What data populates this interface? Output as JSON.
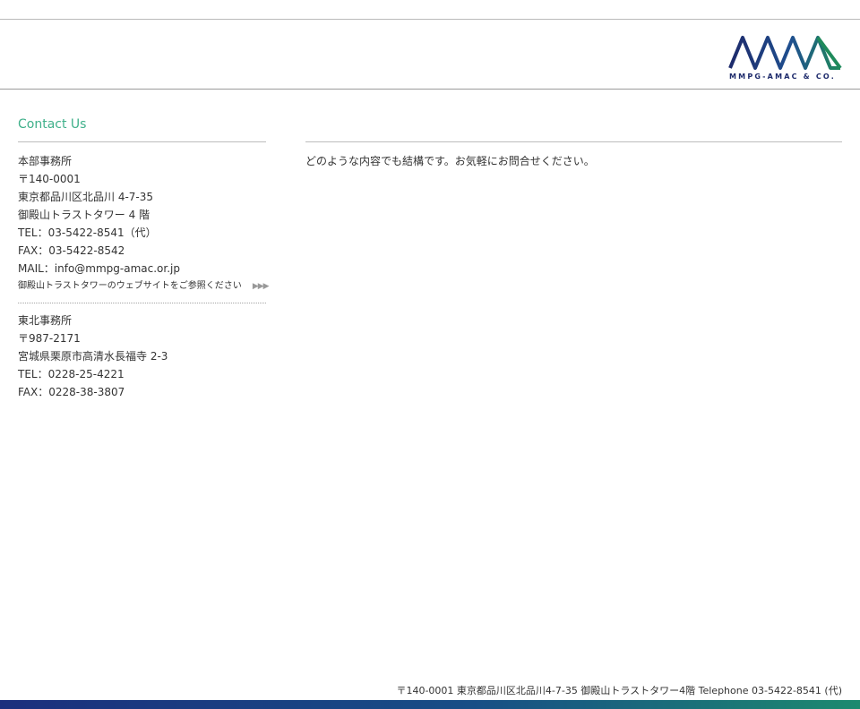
{
  "header": {
    "logo": {
      "text": "MMPG-AMAC & CO.",
      "colors": {
        "navy": "#1d2a6b",
        "blue": "#1f4f8f",
        "green": "#1f8a5b"
      }
    }
  },
  "contact": {
    "title": "Contact Us",
    "main_office": {
      "name": "本部事務所",
      "postal": "〒140-0001",
      "address": "東京都品川区北品川 4-7-35",
      "building": "御殿山トラストタワー 4 階",
      "tel": "TEL：03-5422-8541（代）",
      "fax": "FAX：03-5422-8542",
      "mail": "MAIL：info@mmpg-amac.or.jp",
      "website_link": "御殿山トラストタワーのウェブサイトをご参照ください",
      "website_link_icon": "triple-arrow-icon"
    },
    "tohoku_office": {
      "name": "東北事務所",
      "postal": "〒987-2171",
      "address": "宮城県栗原市高清水長福寺 2-3",
      "tel": "TEL：0228-25-4221",
      "fax": "FAX：0228-38-3807"
    },
    "message": "どのような内容でも結構です。お気軽にお問合せください。"
  },
  "footer": {
    "address": "〒140-0001 東京都品川区北品川4-7-35 御殿山トラストタワー4階  Telephone 03-5422-8541 (代)",
    "bar_colors": {
      "start": "#1b2f7d",
      "end": "#1c8a6f"
    }
  },
  "colors": {
    "accent_green": "#3fb08a",
    "text": "#333333",
    "rule": "#bdbdbd"
  }
}
